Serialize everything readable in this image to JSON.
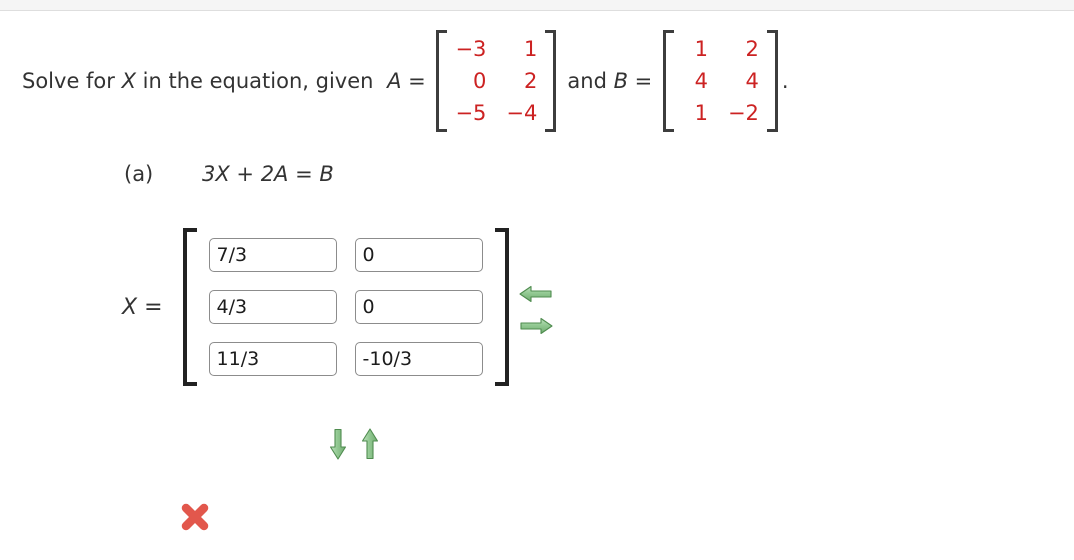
{
  "top_strip": {
    "background": "#f5f5f5",
    "border": "#dedede"
  },
  "colors": {
    "matrix_red": "#cc2222",
    "arrow_green": "#7cb97c",
    "arrow_green_dark": "#4f8c4f",
    "incorrect_red": "#e2574c",
    "text": "#333333"
  },
  "prompt": {
    "lead": "Solve for ",
    "var_x": "X",
    "mid": " in the equation, given ",
    "a_label": "A",
    "equals": " = ",
    "conjunction": "and ",
    "b_label": "B",
    "period": "."
  },
  "given": {
    "matrix_a": {
      "name": "A",
      "rows": [
        [
          "−3",
          "1"
        ],
        [
          "0",
          "2"
        ],
        [
          "−5",
          "−4"
        ]
      ]
    },
    "matrix_b": {
      "name": "B",
      "rows": [
        [
          "1",
          "2"
        ],
        [
          "4",
          "4"
        ],
        [
          "1",
          "−2"
        ]
      ]
    }
  },
  "part_a": {
    "label": "(a)",
    "equation": "3X + 2A = B"
  },
  "answer": {
    "label_var": "X",
    "label_equals": " =",
    "inputs": [
      {
        "value": "7/3",
        "placeholder": ""
      },
      {
        "value": "0",
        "placeholder": ""
      },
      {
        "value": "4/3",
        "placeholder": ""
      },
      {
        "value": "0",
        "placeholder": ""
      },
      {
        "value": "11/3",
        "placeholder": ""
      },
      {
        "value": "-10/3",
        "placeholder": ""
      }
    ],
    "matrix_values": [
      [
        "7/3",
        "0"
      ],
      [
        "4/3",
        "0"
      ],
      [
        "11/3",
        "-10/3"
      ]
    ]
  },
  "controls": {
    "side": [
      {
        "icon": "arrow-left-icon",
        "name": "remove-column-button"
      },
      {
        "icon": "arrow-right-icon",
        "name": "add-column-button"
      }
    ],
    "bottom": [
      {
        "icon": "arrow-down-icon",
        "name": "add-row-button"
      },
      {
        "icon": "arrow-up-icon",
        "name": "remove-row-button"
      }
    ]
  },
  "feedback": {
    "status": "incorrect",
    "icon": "cross-mark-icon"
  }
}
